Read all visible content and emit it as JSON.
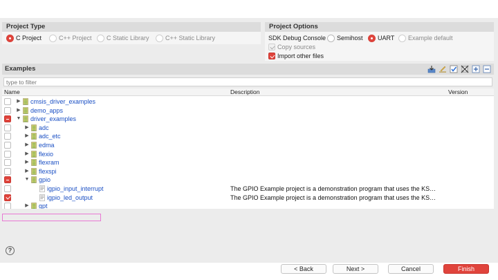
{
  "project_type": {
    "header": "Project Type",
    "options": [
      {
        "label": "C Project",
        "selected": true,
        "enabled": true
      },
      {
        "label": "C++ Project",
        "selected": false,
        "enabled": false
      },
      {
        "label": "C Static Library",
        "selected": false,
        "enabled": false
      },
      {
        "label": "C++ Static Library",
        "selected": false,
        "enabled": false
      }
    ]
  },
  "project_options": {
    "header": "Project Options",
    "sdk_debug_console": {
      "label": "SDK Debug Console",
      "options": [
        {
          "label": "Semihost",
          "selected": false
        },
        {
          "label": "UART",
          "selected": true
        },
        {
          "label": "Example default",
          "selected": false
        }
      ]
    },
    "copy_sources": {
      "label": "Copy sources",
      "checked": true,
      "enabled": false
    },
    "import_other_files": {
      "label": "Import other files",
      "checked": true,
      "enabled": true
    }
  },
  "examples": {
    "header": "Examples",
    "filter_placeholder": "type to filter",
    "columns": {
      "name": "Name",
      "description": "Description",
      "version": "Version"
    },
    "rows": [
      {
        "name": "cmsis_driver_examples",
        "level": 0,
        "twisty": "collapsed",
        "check": "off",
        "icon": "folder-icon",
        "description": ""
      },
      {
        "name": "demo_apps",
        "level": 0,
        "twisty": "collapsed",
        "check": "off",
        "icon": "folder-icon",
        "description": ""
      },
      {
        "name": "driver_examples",
        "level": 0,
        "twisty": "expanded",
        "check": "partial",
        "icon": "folder-icon",
        "description": ""
      },
      {
        "name": "adc",
        "level": 1,
        "twisty": "collapsed",
        "check": "off",
        "icon": "folder-icon",
        "description": ""
      },
      {
        "name": "adc_etc",
        "level": 1,
        "twisty": "collapsed",
        "check": "off",
        "icon": "folder-icon",
        "description": ""
      },
      {
        "name": "edma",
        "level": 1,
        "twisty": "collapsed",
        "check": "off",
        "icon": "folder-icon",
        "description": ""
      },
      {
        "name": "flexio",
        "level": 1,
        "twisty": "collapsed",
        "check": "off",
        "icon": "folder-icon",
        "description": ""
      },
      {
        "name": "flexram",
        "level": 1,
        "twisty": "collapsed",
        "check": "off",
        "icon": "folder-icon",
        "description": ""
      },
      {
        "name": "flexspi",
        "level": 1,
        "twisty": "collapsed",
        "check": "off",
        "icon": "folder-icon",
        "description": ""
      },
      {
        "name": "gpio",
        "level": 1,
        "twisty": "expanded",
        "check": "partial",
        "icon": "folder-icon",
        "description": ""
      },
      {
        "name": "igpio_input_interrupt",
        "level": 2,
        "twisty": "none",
        "check": "off",
        "icon": "project-icon",
        "description": "The GPIO Example project is a demonstration program that uses the KS…"
      },
      {
        "name": "igpio_led_output",
        "level": 2,
        "twisty": "none",
        "check": "on",
        "icon": "project-icon",
        "description": "The GPIO Example project is a demonstration program that uses the KS…"
      },
      {
        "name": "gpt",
        "level": 1,
        "twisty": "collapsed",
        "check": "off",
        "icon": "folder-icon",
        "description": ""
      }
    ]
  },
  "buttons": {
    "help": "?",
    "back": "< Back",
    "next": "Next >",
    "cancel": "Cancel",
    "finish": "Finish"
  },
  "colors": {
    "accent": "#e0443c",
    "link": "#1a4fc4",
    "highlight": "#e878d4"
  }
}
